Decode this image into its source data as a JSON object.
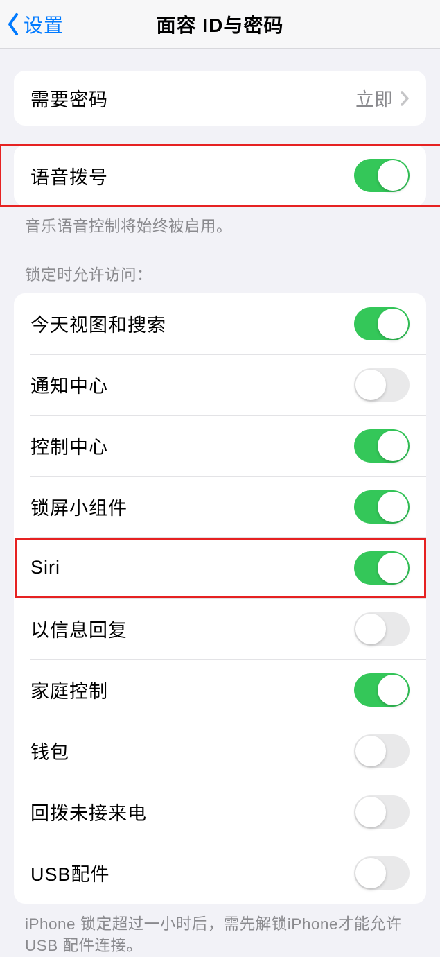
{
  "nav": {
    "back_label": "设置",
    "title": "面容 ID与密码"
  },
  "require_passcode": {
    "label": "需要密码",
    "value": "立即"
  },
  "voice_dial": {
    "label": "语音拨号",
    "on": true,
    "footer": "音乐语音控制将始终被启用。"
  },
  "lock_section": {
    "header": "锁定时允许访问：",
    "items": [
      {
        "label": "今天视图和搜索",
        "on": true
      },
      {
        "label": "通知中心",
        "on": false
      },
      {
        "label": "控制中心",
        "on": true
      },
      {
        "label": "锁屏小组件",
        "on": true
      },
      {
        "label": "Siri",
        "on": true
      },
      {
        "label": "以信息回复",
        "on": false
      },
      {
        "label": "家庭控制",
        "on": true
      },
      {
        "label": "钱包",
        "on": false
      },
      {
        "label": "回拨未接来电",
        "on": false
      },
      {
        "label": "USB配件",
        "on": false
      }
    ],
    "footer": "iPhone 锁定超过一小时后，需先解锁iPhone才能允许USB 配件连接。"
  }
}
